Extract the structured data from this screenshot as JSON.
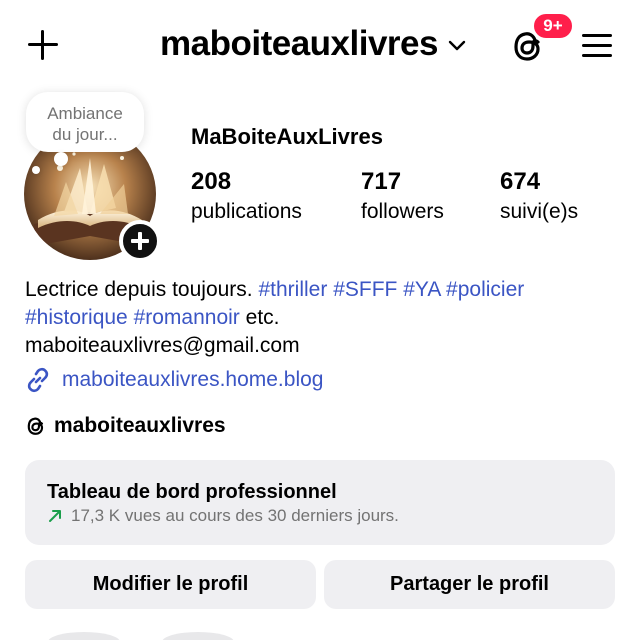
{
  "header": {
    "username": "maboiteauxlivres",
    "notification_badge": "9+",
    "icons": {
      "create": "plus-icon",
      "account_switch": "chevron-down-icon",
      "threads": "threads-icon",
      "menu": "hamburger-menu-icon"
    }
  },
  "profile": {
    "note": "Ambiance du jour...",
    "display_name": "MaBoiteAuxLivres",
    "stats": [
      {
        "value": "208",
        "label": "publications"
      },
      {
        "value": "717",
        "label": "followers"
      },
      {
        "value": "674",
        "label": "suivi(e)s"
      }
    ],
    "bio": {
      "intro": "Lectrice depuis toujours.",
      "hashtags": [
        "#thriller",
        "#SFFF",
        "#YA",
        "#policier",
        "#historique",
        "#romannoir"
      ],
      "outro": "etc."
    },
    "email": "maboiteauxlivres@gmail.com",
    "website": "maboiteauxlivres.home.blog",
    "threads_handle": "maboiteauxlivres"
  },
  "dashboard": {
    "title": "Tableau de bord professionnel",
    "subtitle": "17,3 K vues au cours des 30 derniers jours."
  },
  "actions": {
    "edit_profile": "Modifier le profil",
    "share_profile": "Partager le profil"
  },
  "colors": {
    "badge": "#ff1f4b",
    "link": "#3b55c4",
    "trend_up": "#1a9e4b",
    "button_bg": "#efeff2"
  }
}
